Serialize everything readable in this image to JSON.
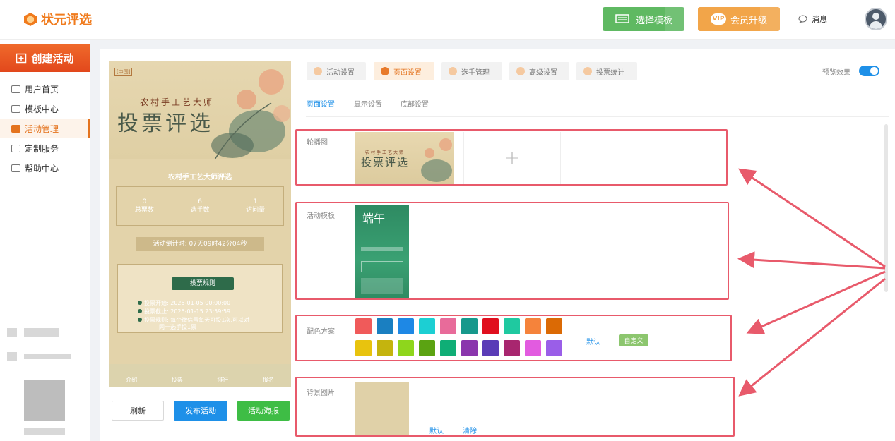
{
  "app": {
    "name": "状元评选"
  },
  "topbar": {
    "template_button": "选择模板",
    "vip_badge": "VIP",
    "vip_button": "会员升级",
    "messages": "消息"
  },
  "sidebar": {
    "create": "创建活动",
    "items": [
      {
        "label": "用户首页",
        "icon": "home-icon"
      },
      {
        "label": "模板中心",
        "icon": "folder-icon"
      },
      {
        "label": "活动管理",
        "icon": "ticket-icon"
      },
      {
        "label": "定制服务",
        "icon": "custom-icon"
      },
      {
        "label": "帮助中心",
        "icon": "help-icon"
      }
    ]
  },
  "preview": {
    "tag": "[中国]",
    "subtitle": "农村手工艺大师",
    "title": "投票评选",
    "name": "农村手工艺大师评选",
    "stats": [
      {
        "value": "0",
        "label": "总票数"
      },
      {
        "value": "6",
        "label": "选手数"
      },
      {
        "value": "1",
        "label": "访问量"
      }
    ],
    "countdown": "活动倒计时: 07天09时42分04秒",
    "rules_title": "投票规则",
    "rules": [
      "投票开始: 2025-01-05 00:00:00",
      "投票截止: 2025-01-15 23:59:59",
      "投票规则: 每个微信号每天可投1次,可以对",
      "同一选手投1票"
    ],
    "tabs": [
      "介绍",
      "投票",
      "排行",
      "报名"
    ]
  },
  "actions": {
    "refresh": "刷新",
    "publish": "发布活动",
    "poster": "活动海报"
  },
  "tabs": [
    {
      "label": "活动设置"
    },
    {
      "label": "页面设置",
      "active": true
    },
    {
      "label": "选手管理"
    },
    {
      "label": "高级设置"
    },
    {
      "label": "投票统计"
    }
  ],
  "preview_toggle": {
    "label": "预览效果",
    "on": true
  },
  "subtabs": [
    "页面设置",
    "显示设置",
    "底部设置"
  ],
  "sections": {
    "banner": {
      "label": "轮播图",
      "thumb_subtitle": "农村手工艺大师",
      "thumb_title": "投票评选",
      "add": "+"
    },
    "template": {
      "label": "活动模板",
      "thumb_glyph": "端午"
    },
    "colors": {
      "label": "配色方案",
      "row1": [
        "#f05a5a",
        "#1a7fc1",
        "#1e88e5",
        "#1ccfd3",
        "#e86b9a",
        "#17998c",
        "#e00f1e",
        "#1fc9a0",
        "#f5833b",
        "#db6a05"
      ],
      "row2": [
        "#e8c30e",
        "#c4b40e",
        "#8ed61c",
        "#5ba312",
        "#0fae76",
        "#8a36ad",
        "#5a3cb7",
        "#a8266f",
        "#e25be0",
        "#9a5ee8"
      ],
      "default": "默认",
      "custom": "自定义"
    },
    "background": {
      "label": "背景图片",
      "default": "默认",
      "clear": "清除",
      "color": "#e0d1a8"
    }
  },
  "colors": {
    "accent": "#e4731e",
    "blue": "#1e90e8",
    "green": "#3ebd45",
    "annotation": "#e85a6b"
  }
}
